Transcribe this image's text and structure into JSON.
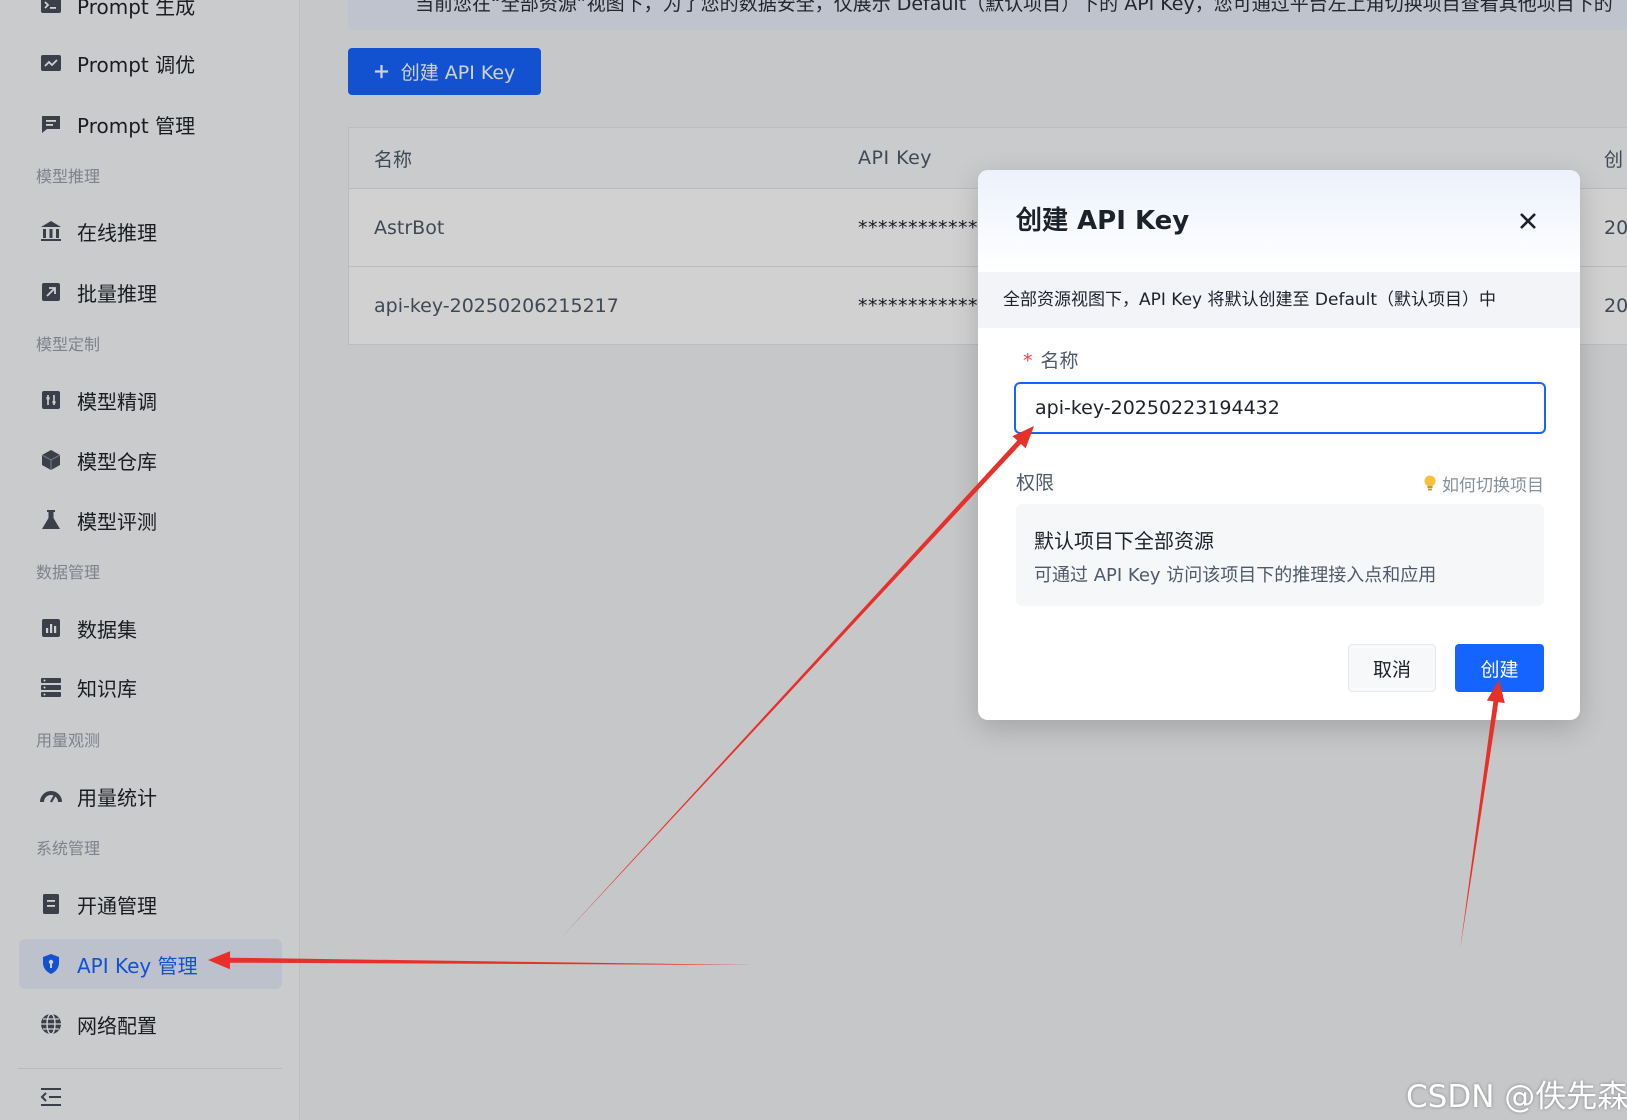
{
  "sidebar": {
    "top_items": [
      {
        "label": "Prompt 生成",
        "icon": "prompt-generate-icon"
      },
      {
        "label": "Prompt 调优",
        "icon": "prompt-tune-icon"
      },
      {
        "label": "Prompt 管理",
        "icon": "prompt-manage-icon"
      }
    ],
    "sections": [
      {
        "title": "模型推理",
        "items": [
          {
            "label": "在线推理",
            "icon": "bank-icon"
          },
          {
            "label": "批量推理",
            "icon": "rocket-icon"
          }
        ]
      },
      {
        "title": "模型定制",
        "items": [
          {
            "label": "模型精调",
            "icon": "tune-icon"
          },
          {
            "label": "模型仓库",
            "icon": "cube-icon"
          },
          {
            "label": "模型评测",
            "icon": "flask-icon"
          }
        ]
      },
      {
        "title": "数据管理",
        "items": [
          {
            "label": "数据集",
            "icon": "bar-chart-icon"
          },
          {
            "label": "知识库",
            "icon": "server-icon"
          }
        ]
      },
      {
        "title": "用量观测",
        "items": [
          {
            "label": "用量统计",
            "icon": "gauge-icon"
          }
        ]
      },
      {
        "title": "系统管理",
        "items": [
          {
            "label": "开通管理",
            "icon": "clipboard-icon"
          },
          {
            "label": "API Key 管理",
            "icon": "shield-icon",
            "active": true
          },
          {
            "label": "网络配置",
            "icon": "globe-icon"
          }
        ]
      }
    ],
    "collapse_icon": "collapse-menu-icon"
  },
  "notice": {
    "text": "当前您在“全部资源”视图下，为了您的数据安全，仅展示 Default（默认项目）下的 API Key，您可通过平台左上角切换项目查看其他项目下的"
  },
  "create_button": {
    "label": "创建 API Key",
    "icon": "plus-icon"
  },
  "table": {
    "columns": [
      "名称",
      "API Key",
      "创"
    ],
    "rows": [
      {
        "name": "AstrBot",
        "api_key": "****************",
        "created": "20"
      },
      {
        "name": "api-key-20250206215217",
        "api_key": "****************",
        "created": "20"
      }
    ]
  },
  "modal": {
    "title": "创建 API Key",
    "close_icon": "close-icon",
    "info": "全部资源视图下，API Key 将默认创建至 Default（默认项目）中",
    "name_field": {
      "required_mark": "*",
      "label": "名称",
      "value": "api-key-20250223194432"
    },
    "permission": {
      "label": "权限",
      "help_icon": "lightbulb-icon",
      "help_link": "如何切换项目",
      "option_title": "默认项目下全部资源",
      "option_desc": "可通过 API Key 访问该项目下的推理接入点和应用"
    },
    "cancel_label": "取消",
    "create_label": "创建"
  },
  "watermark": {
    "text": "CSDN @佚先森"
  },
  "colors": {
    "primary": "#1664ff",
    "annotation": "#e8302a",
    "required": "#f53f3f"
  }
}
